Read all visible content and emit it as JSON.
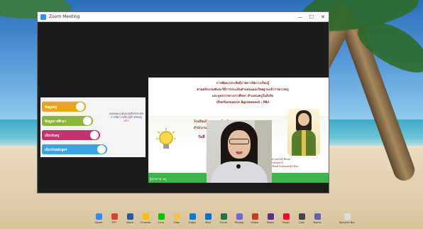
{
  "window": {
    "title": "Zoom Meeting",
    "controls": {
      "minimize": "—",
      "maximize": "☐",
      "close": "✕"
    }
  },
  "menu_slide": {
    "items": [
      {
        "label": "ข้อมูลครู",
        "color": "#e6a31f"
      },
      {
        "label": "ข้อมูลการศึกษา",
        "color": "#8db53a"
      },
      {
        "label": "เกี่ยวกับครู",
        "color": "#c5336d"
      },
      {
        "label": "เกี่ยวกับหลักสูตร",
        "color": "#3ba3df"
      }
    ],
    "caption_line1": "แผนพัฒนาตนเองเพื่อยกระดับ",
    "caption_line2": "การจัดการเรียนรู้สำหรับครู",
    "caption_line3": "VET"
  },
  "presentation_slide": {
    "line1": "การพัฒนาประสิทธิภาพการจัดการเรียนรู้",
    "line2": "ตามหลักเกณฑ์และวิธีการประเมินตำแหน่งและวิทยฐานะข้าราชการครู",
    "line3": "และบุคลากรทางการศึกษา ตำแหน่งครูในสังกัด",
    "line4": "(Performance Agreement : PA)",
    "line5": "โรงเรียนบ้านหนองหญ้าปล้อง",
    "line6": "สำนักงานเขตพื้นที่การศึกษาประถมศึกษา",
    "line7": "วันที่ ... พฤศจิกายน 2564",
    "photo_caption1": "นางสาวพรรณี ชื่นชม",
    "photo_caption2": "ครูชำนาญการ",
    "photo_caption3": "โรงเรียนบ้านหนองหญ้าปล้อง",
    "footer_label": "ผู้บรรยาย: ครู",
    "accent_color": "#3cb44a"
  },
  "taskbar": {
    "items": [
      {
        "label": "Zoom",
        "icon": "zoom-icon",
        "color": "#2d8cff"
      },
      {
        "label": "PPT",
        "icon": "powerpoint-icon",
        "color": "#d24726"
      },
      {
        "label": "Word",
        "icon": "word-icon",
        "color": "#2b579a"
      },
      {
        "label": "Chrome",
        "icon": "chrome-icon",
        "color": "#fbbc05"
      },
      {
        "label": "Line",
        "icon": "line-icon",
        "color": "#00c300"
      },
      {
        "label": "Files",
        "icon": "folder-icon",
        "color": "#f2c14e"
      },
      {
        "label": "Edge",
        "icon": "edge-icon",
        "color": "#0078d7"
      },
      {
        "label": "Mail",
        "icon": "mail-icon",
        "color": "#0072c6"
      },
      {
        "label": "Excel",
        "icon": "excel-icon",
        "color": "#217346"
      },
      {
        "label": "Photos",
        "icon": "photos-icon",
        "color": "#6b69d6"
      },
      {
        "label": "Video",
        "icon": "video-icon",
        "color": "#c23b22"
      },
      {
        "label": "Store",
        "icon": "store-icon",
        "color": "#5c2d91"
      },
      {
        "label": "Paint",
        "icon": "paint-icon",
        "color": "#e81123"
      },
      {
        "label": "Calc",
        "icon": "calculator-icon",
        "color": "#444444"
      },
      {
        "label": "Teams",
        "icon": "teams-icon",
        "color": "#6264a7"
      },
      {
        "label": "Recycle Bin",
        "icon": "recycle-bin-icon",
        "color": "#dddddd"
      }
    ]
  }
}
